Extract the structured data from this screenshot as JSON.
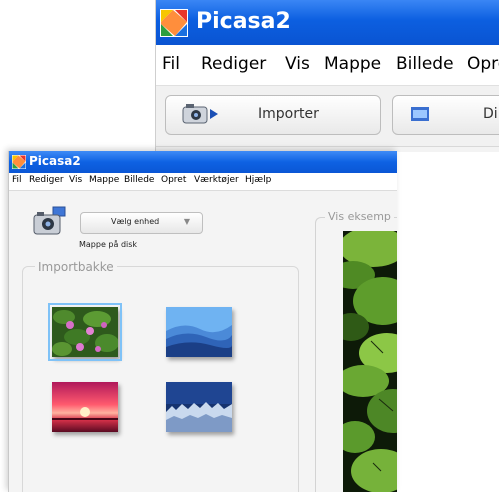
{
  "app_title": "Picasa2",
  "back_window": {
    "menu": [
      "Fil",
      "Rediger",
      "Vis",
      "Mappe",
      "Billede",
      "Opret"
    ],
    "import_button_label": "Importer",
    "other_button_label": "Di"
  },
  "front_window": {
    "menu": [
      "Fil",
      "Rediger",
      "Vis",
      "Mappe",
      "Billede",
      "Opret",
      "Værktøjer",
      "Hjælp"
    ],
    "device_select_value": "Vælg enhed",
    "folder_on_disk_link": "Mappe på disk",
    "import_tray_title": "Importbakke",
    "preview_title": "Vis eksemp",
    "thumbnails": [
      {
        "name": "water-lilies",
        "selected": true
      },
      {
        "name": "blue-hills",
        "selected": false
      },
      {
        "name": "sunset",
        "selected": false
      },
      {
        "name": "winter",
        "selected": false
      }
    ]
  },
  "colors": {
    "titlebar": "#0c5fe0",
    "selection_outline": "#7fc2f7",
    "group_caption": "#999999"
  }
}
